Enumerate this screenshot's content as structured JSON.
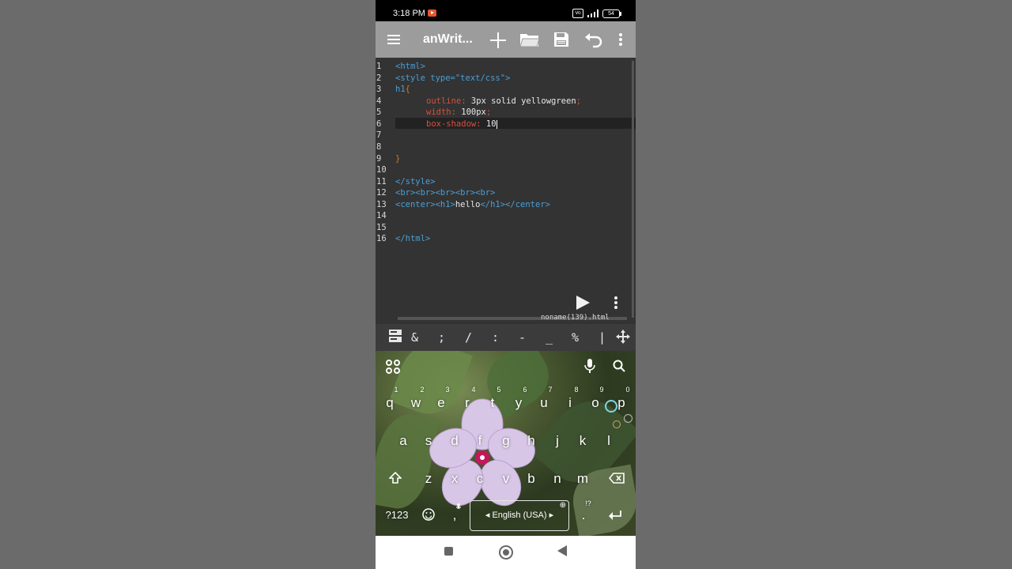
{
  "status": {
    "time": "3:18 PM",
    "vol_badge": "Vo",
    "battery": "54"
  },
  "appbar": {
    "title": "anWrit..."
  },
  "editor": {
    "line_numbers": [
      "1",
      "2",
      "3",
      "4",
      "5",
      "6",
      "7",
      "8",
      "9",
      "10",
      "11",
      "12",
      "13",
      "14",
      "15",
      "16"
    ],
    "lines": {
      "l1": "<html>",
      "l2": "<style type=\"text/css\">",
      "l3_sel": "h1",
      "l3_brace": "{",
      "l4_prop": "outline:",
      "l4_val": " 3px solid yellowgreen",
      "l4_semi": ";",
      "l5_prop": "width:",
      "l5_val": " 100px",
      "l5_semi": ";",
      "l6_prop": "box-shadow:",
      "l6_val": " 10",
      "l9": "}",
      "l11": "</style>",
      "l12": "<br><br><br><br><br>",
      "l13_open": "<center><h1>",
      "l13_text": "hello",
      "l13_close": "</h1></center>",
      "l16": "</html>"
    },
    "filename": "noname(139).html"
  },
  "symbolbar": {
    "symbols": [
      "&",
      ";",
      "/",
      ":",
      "-",
      "_",
      "%",
      "|"
    ]
  },
  "keyboard": {
    "row1": [
      "q",
      "w",
      "e",
      "r",
      "t",
      "y",
      "u",
      "i",
      "o",
      "p"
    ],
    "row1_hints": [
      "1",
      "2",
      "3",
      "4",
      "5",
      "6",
      "7",
      "8",
      "9",
      "0"
    ],
    "row2": [
      "a",
      "s",
      "d",
      "f",
      "g",
      "h",
      "j",
      "k",
      "l"
    ],
    "row3": [
      "z",
      "x",
      "c",
      "v",
      "b",
      "n",
      "m"
    ],
    "numbers_key": "?123",
    "comma": ",",
    "period": ".",
    "period_hint": "!?",
    "space_label": "English (USA)"
  }
}
